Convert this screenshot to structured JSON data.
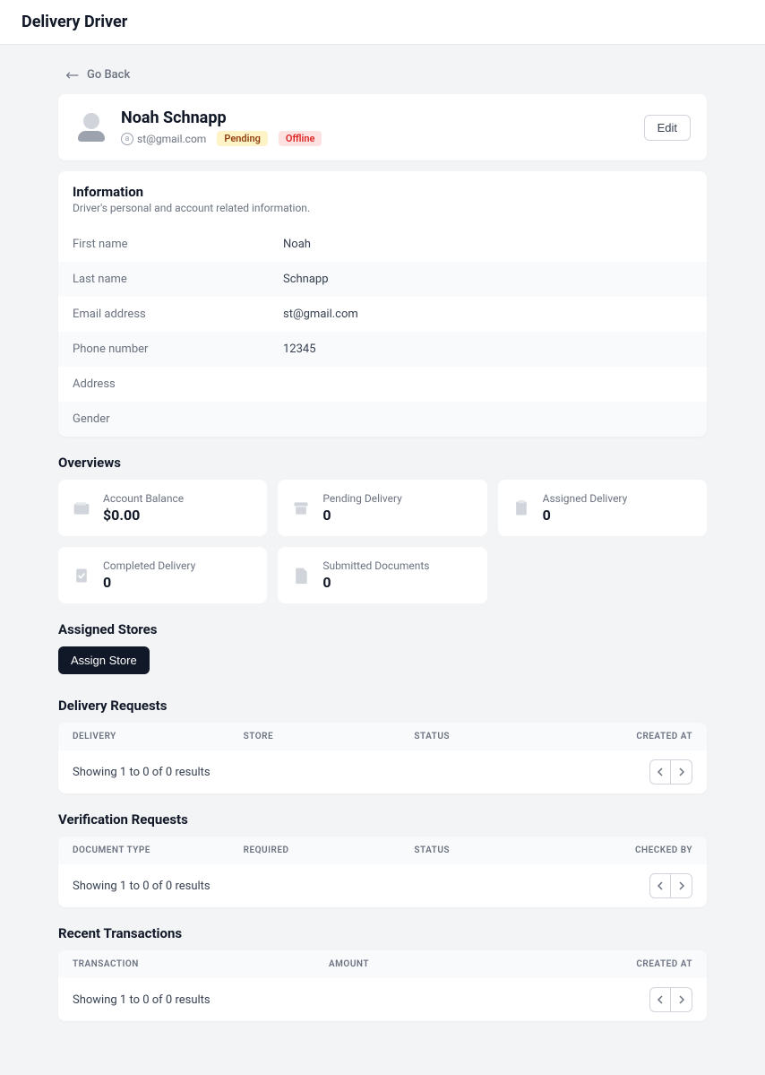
{
  "topbar": {
    "title": "Delivery Driver"
  },
  "nav": {
    "go_back": "Go Back"
  },
  "profile": {
    "name": "Noah Schnapp",
    "email": "st@gmail.com",
    "status_badge": "Pending",
    "presence_badge": "Offline",
    "edit_label": "Edit"
  },
  "info_section": {
    "title": "Information",
    "subtitle": "Driver's personal and account related information.",
    "rows": [
      {
        "label": "First name",
        "value": "Noah"
      },
      {
        "label": "Last name",
        "value": "Schnapp"
      },
      {
        "label": "Email address",
        "value": "st@gmail.com"
      },
      {
        "label": "Phone number",
        "value": "12345"
      },
      {
        "label": "Address",
        "value": ""
      },
      {
        "label": "Gender",
        "value": ""
      }
    ]
  },
  "overviews": {
    "title": "Overviews",
    "tiles": [
      {
        "label": "Account Balance",
        "value": "$0.00",
        "icon": "wallet-icon"
      },
      {
        "label": "Pending Delivery",
        "value": "0",
        "icon": "archive-icon"
      },
      {
        "label": "Assigned Delivery",
        "value": "0",
        "icon": "clipboard-icon"
      },
      {
        "label": "Completed Delivery",
        "value": "0",
        "icon": "check-clipboard-icon"
      },
      {
        "label": "Submitted Documents",
        "value": "0",
        "icon": "document-icon"
      }
    ]
  },
  "assigned_stores": {
    "title": "Assigned Stores",
    "assign_label": "Assign Store"
  },
  "delivery_requests": {
    "title": "Delivery Requests",
    "columns": [
      "DELIVERY",
      "STORE",
      "STATUS",
      "CREATED AT"
    ],
    "showing": "Showing 1 to 0 of 0 results"
  },
  "verification_requests": {
    "title": "Verification Requests",
    "columns": [
      "DOCUMENT TYPE",
      "REQUIRED",
      "STATUS",
      "CHECKED BY"
    ],
    "showing": "Showing 1 to 0 of 0 results"
  },
  "recent_transactions": {
    "title": "Recent Transactions",
    "columns": [
      "TRANSACTION",
      "AMOUNT",
      "CREATED AT"
    ],
    "showing": "Showing 1 to 0 of 0 results"
  }
}
